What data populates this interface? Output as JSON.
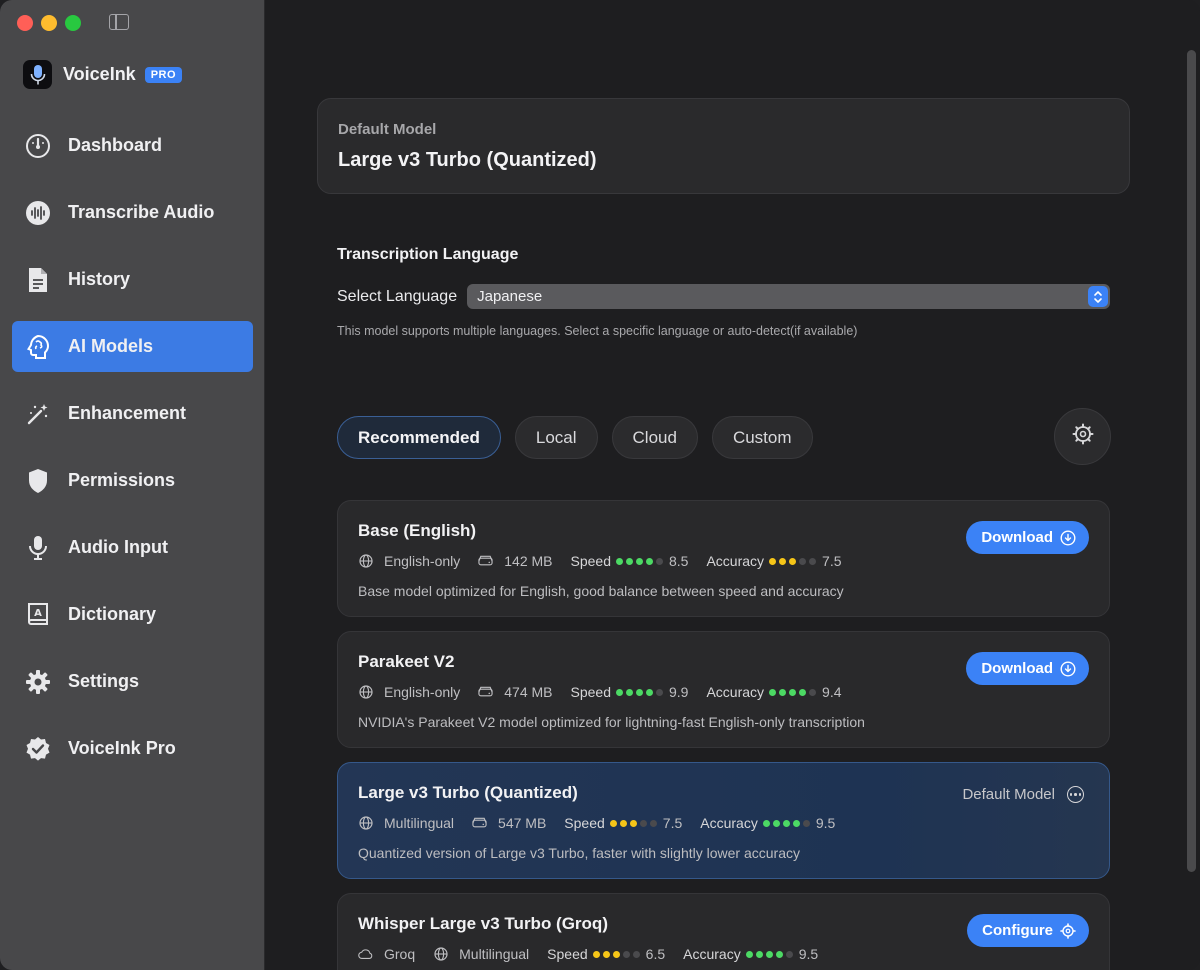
{
  "app": {
    "name": "VoiceInk",
    "badge": "PRO"
  },
  "sidebar": {
    "items": [
      {
        "label": "Dashboard",
        "icon": "gauge-icon"
      },
      {
        "label": "Transcribe Audio",
        "icon": "waveform-icon"
      },
      {
        "label": "History",
        "icon": "document-icon"
      },
      {
        "label": "AI Models",
        "icon": "brain-icon",
        "active": true
      },
      {
        "label": "Enhancement",
        "icon": "magic-wand-icon"
      },
      {
        "label": "Permissions",
        "icon": "shield-icon"
      },
      {
        "label": "Audio Input",
        "icon": "microphone-icon"
      },
      {
        "label": "Dictionary",
        "icon": "dictionary-icon"
      },
      {
        "label": "Settings",
        "icon": "gear-icon"
      },
      {
        "label": "VoiceInk Pro",
        "icon": "checkmark-seal-icon"
      }
    ]
  },
  "default_model": {
    "label": "Default Model",
    "value": "Large v3 Turbo (Quantized)"
  },
  "language": {
    "title": "Transcription Language",
    "select_label": "Select Language",
    "selected": "Japanese",
    "help": "This model supports multiple languages. Select a specific language or auto-detect(if available)"
  },
  "tabs": [
    {
      "label": "Recommended",
      "active": true
    },
    {
      "label": "Local"
    },
    {
      "label": "Cloud"
    },
    {
      "label": "Custom"
    }
  ],
  "models": [
    {
      "name": "Base (English)",
      "provider": "",
      "language": "English-only",
      "size": "142 MB",
      "speed_label": "Speed",
      "speed": "8.5",
      "speed_dots": 4,
      "speed_color": "#4cd964",
      "accuracy_label": "Accuracy",
      "accuracy": "7.5",
      "accuracy_dots": 3,
      "accuracy_color": "#f5c518",
      "description": "Base model optimized for English, good balance between speed and accuracy",
      "action": "Download"
    },
    {
      "name": "Parakeet V2",
      "provider": "",
      "language": "English-only",
      "size": "474 MB",
      "speed_label": "Speed",
      "speed": "9.9",
      "speed_dots": 4,
      "speed_color": "#4cd964",
      "accuracy_label": "Accuracy",
      "accuracy": "9.4",
      "accuracy_dots": 4,
      "accuracy_color": "#4cd964",
      "description": "NVIDIA's Parakeet V2 model optimized for lightning-fast English-only transcription",
      "action": "Download"
    },
    {
      "name": "Large v3 Turbo (Quantized)",
      "provider": "",
      "language": "Multilingual",
      "size": "547 MB",
      "speed_label": "Speed",
      "speed": "7.5",
      "speed_dots": 3,
      "speed_color": "#f5c518",
      "accuracy_label": "Accuracy",
      "accuracy": "9.5",
      "accuracy_dots": 4,
      "accuracy_color": "#4cd964",
      "description": "Quantized version of Large v3 Turbo, faster with slightly lower accuracy",
      "action": "",
      "default_tag": "Default Model"
    },
    {
      "name": "Whisper Large v3 Turbo (Groq)",
      "provider": "Groq",
      "language": "Multilingual",
      "size": "",
      "speed_label": "Speed",
      "speed": "6.5",
      "speed_dots": 3,
      "speed_color": "#f5c518",
      "accuracy_label": "Accuracy",
      "accuracy": "9.5",
      "accuracy_dots": 4,
      "accuracy_color": "#4cd964",
      "description": "",
      "action": "Configure"
    }
  ],
  "colors": {
    "accent": "#3b82f6",
    "sidebar_bg": "#48484a",
    "main_bg": "#1e1e20"
  }
}
